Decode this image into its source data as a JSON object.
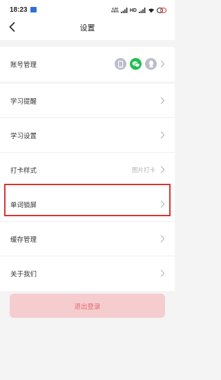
{
  "status_bar": {
    "time": "18:23",
    "speed_value": "4.00",
    "speed_unit": "KB/S",
    "hd_label": "HD"
  },
  "header": {
    "title": "设置"
  },
  "account_group": {
    "label": "账号管理",
    "icons": [
      "phone-icon",
      "wechat-icon",
      "qq-icon"
    ]
  },
  "settings_group": {
    "items": [
      {
        "label": "学习提醒"
      },
      {
        "label": "学习设置"
      },
      {
        "label": "打卡样式",
        "value": "图片打卡"
      },
      {
        "label": "单词锁屏"
      },
      {
        "label": "缓存管理"
      },
      {
        "label": "关于我们"
      }
    ]
  },
  "logout": {
    "label": "退出登录"
  },
  "colors": {
    "highlight": "#d9322f",
    "logout_bg": "#f6cdcf",
    "logout_text": "#e06b73",
    "wechat": "#1fbf4f"
  }
}
